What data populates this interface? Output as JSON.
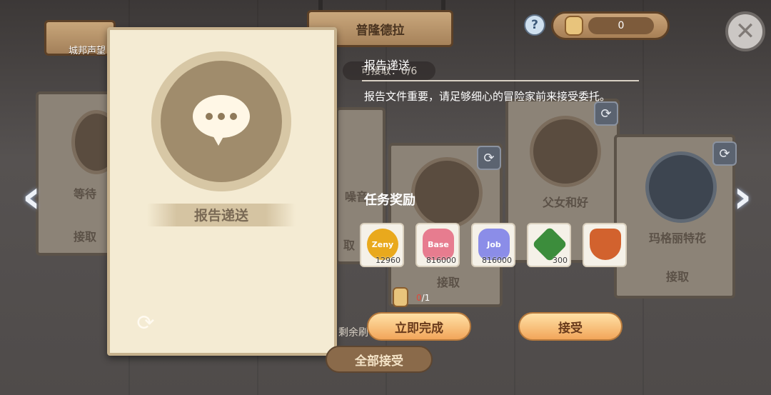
{
  "header": {
    "location": "普隆德拉",
    "city_tab": "城邦声望",
    "help_icon": "?",
    "currency_value": "0",
    "close_icon": "✕"
  },
  "quests_available": "可接取：0/6",
  "background_cards": [
    {
      "label": "等待",
      "action": "接取"
    },
    {
      "label": "噪音",
      "action": "取"
    },
    {
      "label": "",
      "action": "接取"
    },
    {
      "label": "父女和好",
      "action": ""
    },
    {
      "label": "玛格丽特花",
      "action": "接取"
    }
  ],
  "main_card": {
    "title": "报告递送",
    "icon": "chat-bubble-icon"
  },
  "detail": {
    "title": "报告递送",
    "description": "报告文件重要，请足够细心的冒险家前来接受委托。",
    "reward_heading": "任务奖励",
    "rewards": [
      {
        "name": "zeny",
        "amount": "12960",
        "color": "#e9a91d",
        "label": "Zeny"
      },
      {
        "name": "base-exp",
        "amount": "816000",
        "color": "#e77c8f",
        "label": "Base"
      },
      {
        "name": "job-exp",
        "amount": "816000",
        "color": "#8b8de8",
        "label": "Job"
      },
      {
        "name": "trident-token",
        "amount": "300",
        "color": "#3c8d3c",
        "label": ""
      },
      {
        "name": "emblem",
        "amount": "",
        "color": "#d2622e",
        "label": ""
      }
    ],
    "progress_current": "0",
    "progress_total": "/1"
  },
  "buttons": {
    "complete_now": "立即完成",
    "accept": "接受",
    "accept_all": "全部接受",
    "leftover_text": "剩余刷"
  },
  "nav": {
    "prev_icon": "‹",
    "next_icon": "›"
  }
}
